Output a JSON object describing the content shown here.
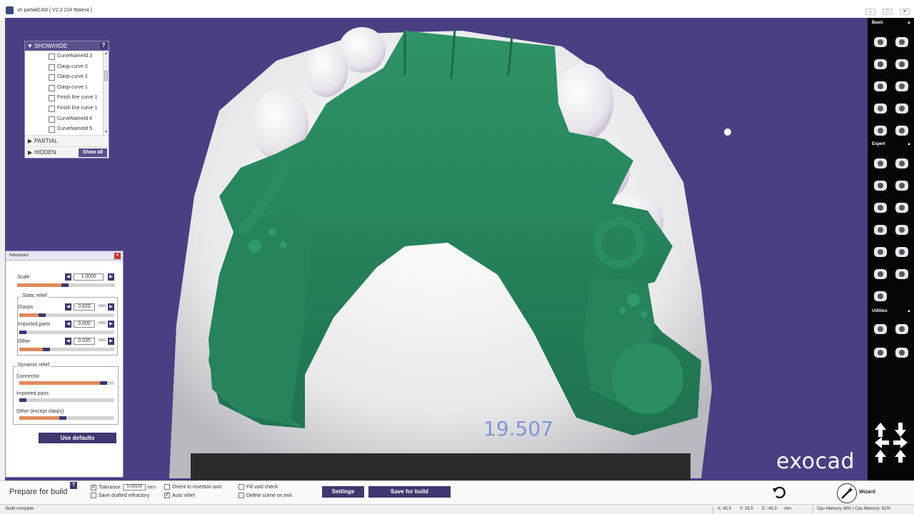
{
  "window": {
    "title": "vh partialCAD [ V2.3 224 Matera ]",
    "min_glyph": "–",
    "max_glyph": "□",
    "close_glyph": "✕"
  },
  "viewport": {
    "watermark": "exocad",
    "background": "#4a3f83",
    "framework_color": "#27835e"
  },
  "showhide": {
    "title": "SHOW/HIDE",
    "help": "?",
    "items": [
      {
        "label": "CurveNameId 3"
      },
      {
        "label": "Clasp curve 3"
      },
      {
        "label": "Clasp curve 2"
      },
      {
        "label": "Clasp curve 1"
      },
      {
        "label": "Finish line curve 1"
      },
      {
        "label": "Finish line curve 1"
      },
      {
        "label": "CurveNameId 4"
      },
      {
        "label": "CurveNameId 5"
      }
    ],
    "partial": "PARTIAL",
    "hidden": "HIDDEN",
    "show_all": "Show all"
  },
  "advanced": {
    "title": "Advanced",
    "close": "✕",
    "scale": {
      "label": "Scale",
      "value": "1.0000"
    },
    "static_relief": {
      "title": "Static relief",
      "rows": [
        {
          "label": "Clasps",
          "value": "0.020",
          "unit": "mm",
          "level": 0.2
        },
        {
          "label": "Imported parts",
          "value": "0.000",
          "unit": "mm",
          "level": 0.0
        },
        {
          "label": "Other",
          "value": "0.035",
          "unit": "mm",
          "level": 0.25
        }
      ]
    },
    "scale_level": 0.45,
    "dynamic_relief": {
      "title": "Dynamic relief",
      "rows": [
        {
          "label": "Connector",
          "level": 0.85
        },
        {
          "label": "Imported parts",
          "level": 0.0
        },
        {
          "label": "Other (except clasps)",
          "level": 0.42
        }
      ]
    },
    "use_defaults": "Use defaults"
  },
  "toolbar": {
    "basic": "Basic",
    "expert": "Expert",
    "utilities": "Utilities",
    "collapse_glyph": "▲",
    "basic_icons": [
      "milling-icon",
      "camera-icon",
      "wave-icon",
      "hook-icon",
      "tooth-blob-icon",
      "toggle-icon",
      "mesh-cap-icon",
      "scan-icon",
      "ribbon-icon",
      "teeth-icon"
    ],
    "expert_icons": [
      "bar-icon",
      "pen-plus-icon",
      "tooth-group-icon",
      "dentures-icon",
      "dots-pattern-icon",
      "lattice-icon",
      "dotted-shape-icon",
      "drop-icon",
      "bead-icon",
      "dots-cluster-icon",
      "stamp-icon",
      "text-icon",
      "layer-icon"
    ],
    "utility_icons": [
      "scissors-icon",
      "pliers-icon",
      "fill-tooth-icon",
      "remove-tooth-icon"
    ]
  },
  "bottom": {
    "prepare": "Prepare for build",
    "help": "?",
    "tolerance_label": "Tolerance:",
    "tolerance_value": "0.00100",
    "tolerance_unit": "mm",
    "tolerance_checked": true,
    "save_drafted": "Save drafted refractory",
    "save_drafted_checked": false,
    "orient": "Orient to insertion axis",
    "orient_checked": false,
    "auto_relief": "Auto relief",
    "auto_relief_checked": true,
    "fill_void": "Fill void check",
    "fill_void_checked": false,
    "delete_scene": "Delete scene on exit",
    "delete_scene_checked": false,
    "settings": "Settings",
    "save_for_build": "Save for build",
    "wizard": "Wizard"
  },
  "status": {
    "left": "Build complete",
    "x": "X:  45.5",
    "y": "Y:  26.5",
    "z": "Z:  -49.3",
    "mm": "mm",
    "memory": "Gpu Memory 38% | Cpu Memory: 62%"
  }
}
